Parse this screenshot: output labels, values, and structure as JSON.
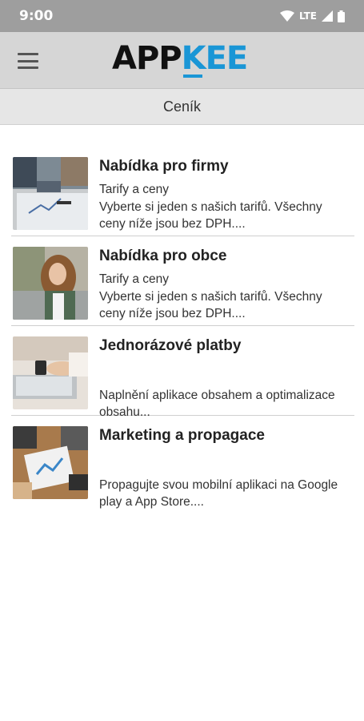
{
  "status": {
    "time": "9:00",
    "network": "LTE"
  },
  "header": {
    "logo_part1": "APP",
    "logo_part2": "KEE",
    "brand_color": "#1a96d6"
  },
  "page": {
    "title": "Ceník"
  },
  "items": [
    {
      "title": "Nabídka pro firmy",
      "subtitle": "Tarify a ceny",
      "description": "Vyberte si jeden s našich tarifů. Všechny ceny níže jsou bez DPH....",
      "image": "business-meeting-image"
    },
    {
      "title": "Nabídka pro obce",
      "subtitle": "Tarify a ceny",
      "description": "Vyberte si jeden s našich tarifů. Všechny ceny níže jsou bez DPH....",
      "image": "woman-with-phone-image"
    },
    {
      "title": "Jednorázové platby",
      "subtitle": "",
      "description": "Naplnění aplikace obsahem a optimalizace obsahu...",
      "image": "laptop-phone-image"
    },
    {
      "title": "Marketing a propagace",
      "subtitle": "",
      "description": "Propagujte svou mobilní aplikaci na Google play a App Store....",
      "image": "desk-charts-image"
    }
  ]
}
